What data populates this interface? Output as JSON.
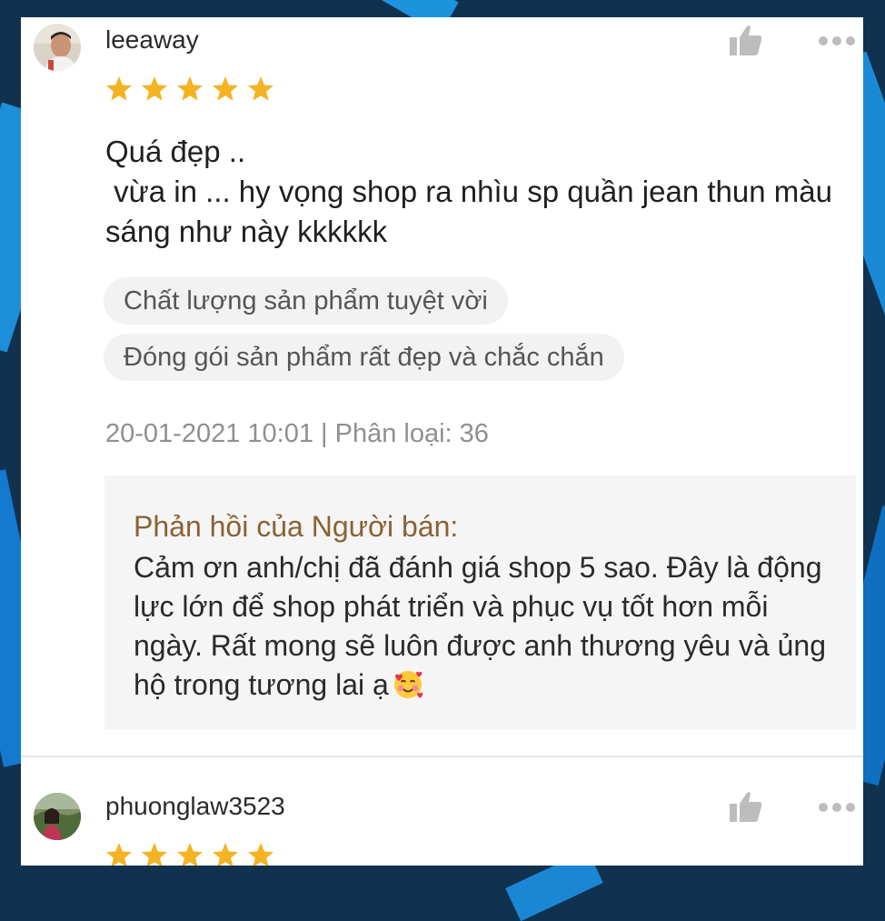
{
  "reviews": [
    {
      "username": "leeaway",
      "rating": 5,
      "text": "Quá đẹp ..\n vừa in ... hy vọng shop ra nhìu sp quần jean thun màu sáng như này kkkkkk",
      "tags": [
        "Chất lượng sản phẩm tuyệt vời",
        "Đóng gói sản phẩm rất đẹp và chắc chắn"
      ],
      "meta": "20-01-2021 10:01 | Phân loại: 36",
      "seller_reply": {
        "title": "Phản hồi của Người bán:",
        "text": "Cảm ơn anh/chị đã đánh giá shop 5 sao. Đây là động lực lớn để shop phát triển và phục vụ tốt hơn mỗi ngày. Rất mong sẽ luôn được anh thương yêu và ủng hộ trong tương lai ạ",
        "emoji": "smiling-face-with-hearts"
      }
    },
    {
      "username": "phuonglaw3523",
      "rating": 5
    }
  ],
  "icons": {
    "like": "thumbs-up-icon",
    "more": "more-options-icon",
    "star": "star-icon"
  },
  "colors": {
    "star": "#f5b323",
    "seller_reply_title": "#8a6233",
    "tag_background": "#f2f2f2",
    "reply_background": "#f5f5f5"
  }
}
